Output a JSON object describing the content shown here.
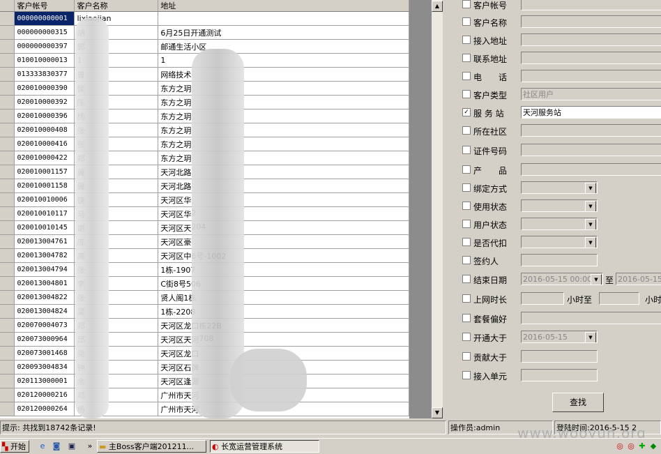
{
  "grid": {
    "headers": [
      "客户帐号",
      "客户名称",
      "地址"
    ],
    "rows": [
      {
        "acct": "000000000001",
        "name": "lixiaojian",
        "addr": ""
      },
      {
        "acct": "000000000315",
        "name": "胡",
        "addr": "6月25日开通测试"
      },
      {
        "acct": "000000000397",
        "name": "郭",
        "addr": "邮通生活小区"
      },
      {
        "acct": "010010000013",
        "name": "1",
        "addr": "1"
      },
      {
        "acct": "013333830377",
        "name": "曾",
        "addr": "网络技术"
      },
      {
        "acct": "020010000390",
        "name": "侯",
        "addr": "东方之玥"
      },
      {
        "acct": "020010000392",
        "name": "陈",
        "addr": "东方之玥"
      },
      {
        "acct": "020010000396",
        "name": "杨",
        "addr": "东方之玥"
      },
      {
        "acct": "020010000408",
        "name": "张",
        "addr": "东方之玥"
      },
      {
        "acct": "020010000416",
        "name": "张",
        "addr": "东方之玥"
      },
      {
        "acct": "020010000422",
        "name": "郑",
        "addr": "东方之玥"
      },
      {
        "acct": "020010001157",
        "name": "冀",
        "addr": "天河北路"
      },
      {
        "acct": "020010001158",
        "name": "冀",
        "addr": "天河北路"
      },
      {
        "acct": "020010010006",
        "name": "饶",
        "addr": "天河区华"
      },
      {
        "acct": "020010010117",
        "name": "马",
        "addr": "天河区华"
      },
      {
        "acct": "020010010145",
        "name": "谢",
        "addr": "天河区天"
      },
      {
        "acct": "020013004761",
        "name": "庞",
        "addr": "天河区豪"
      },
      {
        "acct": "020013004782",
        "name": "高",
        "addr": "天河区中"
      },
      {
        "acct": "020013004794",
        "name": "张",
        "addr": "1栋-1907"
      },
      {
        "acct": "020013004801",
        "name": "李",
        "addr": "C街8号506"
      },
      {
        "acct": "020013004822",
        "name": "张",
        "addr": "贤人阁1栋"
      },
      {
        "acct": "020013004824",
        "name": "梁",
        "addr": "1栋-2208"
      },
      {
        "acct": "020070004073",
        "name": "郑",
        "addr": "天河区龙口"
      },
      {
        "acct": "020073000964",
        "name": "邱",
        "addr": "天河区天河"
      },
      {
        "acct": "020073001468",
        "name": "简",
        "addr": "天河区龙口"
      },
      {
        "acct": "020093004834",
        "name": "钟",
        "addr": "天河区石牌"
      },
      {
        "acct": "020113000001",
        "name": "余",
        "addr": "天河区逢源"
      },
      {
        "acct": "020120000216",
        "name": "邓",
        "addr": "广州市天河"
      },
      {
        "acct": "020120000264",
        "name": "杨",
        "addr": "广州市天河"
      }
    ],
    "addr_tails": [
      "",
      "",
      "",
      "",
      "",
      "",
      "",
      "",
      "",
      "",
      "",
      "",
      "",
      "",
      "2",
      "204",
      "",
      "6号-1002",
      "",
      "",
      "",
      "",
      "栋22B",
      "708",
      "",
      "",
      "",
      "",
      ""
    ]
  },
  "form": {
    "fields": [
      {
        "label": "客户帐号",
        "checked": false,
        "value": ""
      },
      {
        "label": "客户名称",
        "checked": false,
        "value": ""
      },
      {
        "label": "接入地址",
        "checked": false,
        "value": ""
      },
      {
        "label": "联系地址",
        "checked": false,
        "value": ""
      },
      {
        "label": "电　　话",
        "checked": false,
        "value": ""
      },
      {
        "label": "客户类型",
        "checked": false,
        "value": "社区用户"
      },
      {
        "label": "服 务 站",
        "checked": true,
        "value": "天河服务站"
      },
      {
        "label": "所在社区",
        "checked": false,
        "value": ""
      },
      {
        "label": "证件号码",
        "checked": false,
        "value": ""
      },
      {
        "label": "产　　品",
        "checked": false,
        "value": ""
      },
      {
        "label": "绑定方式",
        "checked": false,
        "value": ""
      },
      {
        "label": "使用状态",
        "checked": false,
        "value": ""
      },
      {
        "label": "用户状态",
        "checked": false,
        "value": ""
      },
      {
        "label": "是否代扣",
        "checked": false,
        "value": ""
      },
      {
        "label": "签约人",
        "checked": false,
        "value": ""
      },
      {
        "label": "结束日期",
        "checked": false,
        "value": "2016-05-15 00:00",
        "value2": "2016-05-15",
        "sep": "至"
      },
      {
        "label": "上网时长",
        "checked": false,
        "value": "",
        "unit1": "小时至",
        "unit2": "小时"
      },
      {
        "label": "套餐偏好",
        "checked": false,
        "value": ""
      },
      {
        "label": "开通大于",
        "checked": false,
        "value": "2016-05-15"
      },
      {
        "label": "贡献大于",
        "checked": false,
        "value": ""
      },
      {
        "label": "接入单元",
        "checked": false,
        "value": ""
      }
    ],
    "search_button": "查找"
  },
  "status": {
    "hint": "提示:  共找到18742条记录!",
    "operator": "操作员:admin",
    "login_time": "登陆时间:2016-5-15 2"
  },
  "taskbar": {
    "start": "开始",
    "windows": [
      "主Boss客户端201211...",
      "长宽运营管理系统"
    ]
  },
  "watermark": "www.wooyun.org"
}
